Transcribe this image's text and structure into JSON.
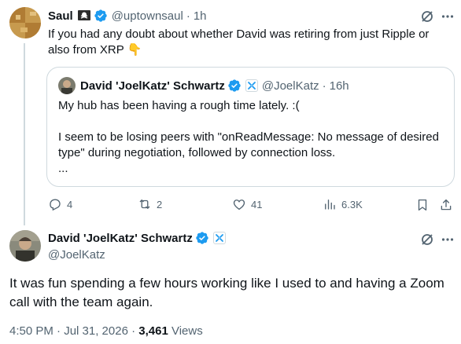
{
  "tweet1": {
    "name": "Saul",
    "handle": "@uptownsaul",
    "sep": "·",
    "time": "1h",
    "text_line1": "If you had any doubt about whether David was retiring from just Ripple or",
    "text_line2": "also from XRP",
    "emoji": "👇"
  },
  "quote": {
    "name": "David 'JoelKatz' Schwartz",
    "handle": "@JoelKatz",
    "sep": "·",
    "time": "16h",
    "line1": "My hub has been having a rough time lately. :(",
    "line2": "I seem to be losing peers with \"onReadMessage: No message of desired",
    "line3": "type\" during negotiation, followed by connection loss.",
    "line4": "..."
  },
  "actions": {
    "replies": "4",
    "retweets": "2",
    "likes": "41",
    "views": "6.3K"
  },
  "tweet2": {
    "name": "David 'JoelKatz' Schwartz",
    "handle": "@JoelKatz",
    "text": "It was fun spending a few hours working like I used to and having a Zoom call with the team again.",
    "date": "4:50 PM · Jul 31, 2026 · ",
    "views_count": "3,461",
    "views_label": " Views"
  },
  "colors": {
    "verified": "#1d9bf0",
    "muted": "#536471",
    "border": "#cfd9de",
    "text": "#0f1419"
  },
  "icons": [
    "pirate-flag-icon",
    "verified-badge-icon",
    "affiliate-badge-icon",
    "grok-icon",
    "more-icon",
    "reply-icon",
    "retweet-icon",
    "like-icon",
    "views-icon",
    "bookmark-icon",
    "share-icon",
    "pointing-down-emoji"
  ]
}
